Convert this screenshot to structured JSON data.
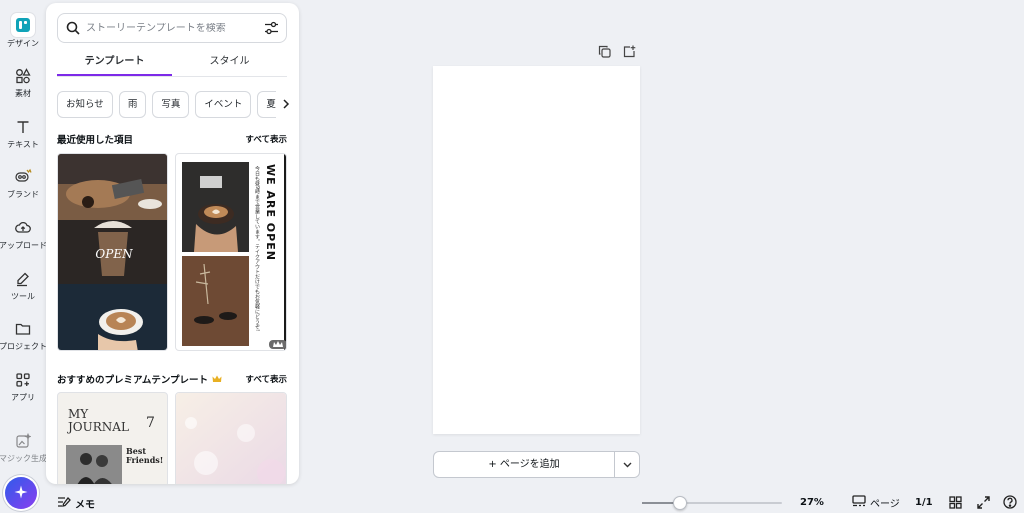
{
  "rail": {
    "items": [
      {
        "label": "デザイン",
        "icon": "design-icon"
      },
      {
        "label": "素材",
        "icon": "elements-icon"
      },
      {
        "label": "テキスト",
        "icon": "text-icon"
      },
      {
        "label": "ブランド",
        "icon": "brand-icon"
      },
      {
        "label": "アップロード",
        "icon": "upload-icon"
      },
      {
        "label": "ツール",
        "icon": "draw-icon"
      },
      {
        "label": "プロジェクト",
        "icon": "folder-icon"
      },
      {
        "label": "アプリ",
        "icon": "apps-icon"
      },
      {
        "label": "マジック生成",
        "icon": "magic-media-icon"
      }
    ],
    "accent": "#7d2ae8"
  },
  "panel": {
    "search_placeholder": "ストーリーテンプレートを検索",
    "tabs": [
      "テンプレート",
      "スタイル"
    ],
    "chips": [
      "お知らせ",
      "雨",
      "写真",
      "イベント",
      "夏"
    ],
    "recent": {
      "title": "最近使用した項目",
      "see_all": "すべて表示",
      "template_a_script": "OPEN",
      "template_b_title": "WE ARE OPEN",
      "template_b_text": "今日も昼9時まで営業しています。テイクアウトだけでもお気軽にどうぞ!"
    },
    "premium": {
      "title": "おすすめのプレミアムテンプレート",
      "see_all": "すべて表示",
      "journal_title": "MY JOURNAL",
      "journal_number": "7",
      "journal_heading": "Best Friends!"
    }
  },
  "canvas": {
    "add_page_label": "+ ページを追加"
  },
  "bottom_bar": {
    "memo_label": "メモ",
    "zoom_level": "27%",
    "zoom_fraction": 0.27,
    "pages_label": "ページ",
    "page_count": "1/1"
  }
}
